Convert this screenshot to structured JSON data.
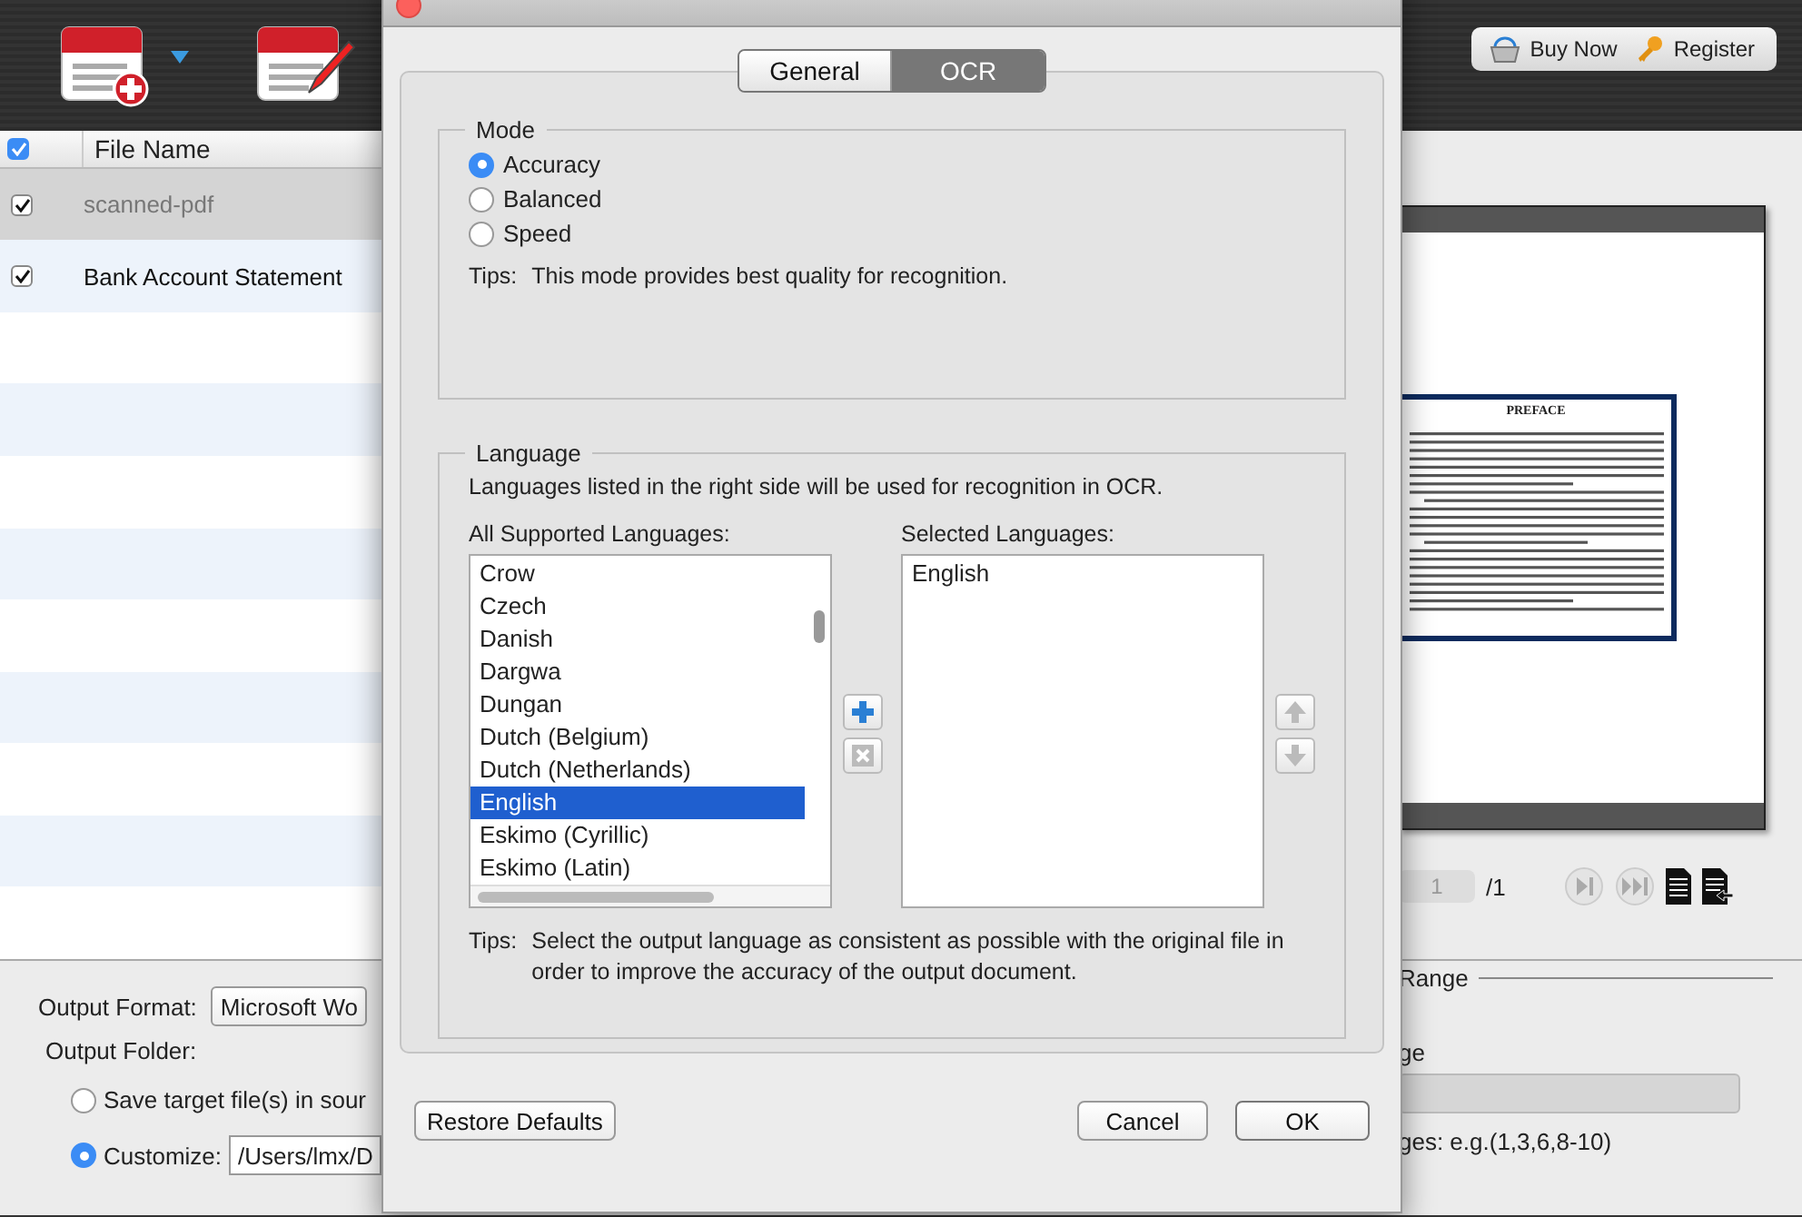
{
  "toolbar": {
    "buttons": [
      "Buy Now",
      "Register"
    ]
  },
  "file_table": {
    "header_checked": true,
    "column": "File Name",
    "rows": [
      {
        "name": "scanned-pdf",
        "checked": true,
        "selected": true
      },
      {
        "name": "Bank Account Statement",
        "checked": true,
        "selected": false
      }
    ]
  },
  "preview": {
    "doc_title": "PREFACE",
    "page": "1",
    "total": "/1"
  },
  "output": {
    "format_label": "Output Format:",
    "format_value": "Microsoft Wo",
    "folder_label": "Output Folder:",
    "options": [
      {
        "label": "Save target file(s) in sour",
        "selected": false
      },
      {
        "label": "Customize:",
        "selected": true,
        "path": "/Users/lmx/D"
      }
    ]
  },
  "page_range": {
    "title": "Range",
    "label": "ge",
    "hint": "ges: e.g.(1,3,6,8-10)"
  },
  "dialog": {
    "tabs": [
      {
        "label": "General",
        "selected": false
      },
      {
        "label": "OCR",
        "selected": true
      }
    ],
    "mode": {
      "title": "Mode",
      "options": [
        {
          "label": "Accuracy",
          "selected": true
        },
        {
          "label": "Balanced",
          "selected": false
        },
        {
          "label": "Speed",
          "selected": false
        }
      ],
      "tips_label": "Tips:",
      "tips": "This mode provides best quality for recognition."
    },
    "language": {
      "title": "Language",
      "intro": "Languages listed in the right side will be used for recognition in OCR.",
      "all_label": "All Supported Languages:",
      "all": [
        {
          "name": "Crow",
          "selected": false
        },
        {
          "name": "Czech",
          "selected": false
        },
        {
          "name": "Danish",
          "selected": false
        },
        {
          "name": "Dargwa",
          "selected": false
        },
        {
          "name": "Dungan",
          "selected": false
        },
        {
          "name": "Dutch (Belgium)",
          "selected": false
        },
        {
          "name": "Dutch (Netherlands)",
          "selected": false
        },
        {
          "name": "English",
          "selected": true
        },
        {
          "name": "Eskimo (Cyrillic)",
          "selected": false
        },
        {
          "name": "Eskimo (Latin)",
          "selected": false
        }
      ],
      "list_buttons": [
        {
          "kind": "add",
          "disabled": false
        },
        {
          "kind": "remove",
          "disabled": true
        }
      ],
      "selected_label": "Selected Languages:",
      "selected": [
        "English"
      ],
      "order_buttons": [
        {
          "kind": "up",
          "disabled": true
        },
        {
          "kind": "down",
          "disabled": true
        }
      ],
      "tips_label": "Tips:",
      "tips": "Select the output language as consistent as possible with the original file in order to improve the accuracy of the output document."
    },
    "buttons": [
      {
        "kind": "plain",
        "label": "Restore Defaults"
      },
      {
        "kind": "plain",
        "label": "Cancel"
      },
      {
        "kind": "default",
        "label": "OK"
      }
    ]
  }
}
